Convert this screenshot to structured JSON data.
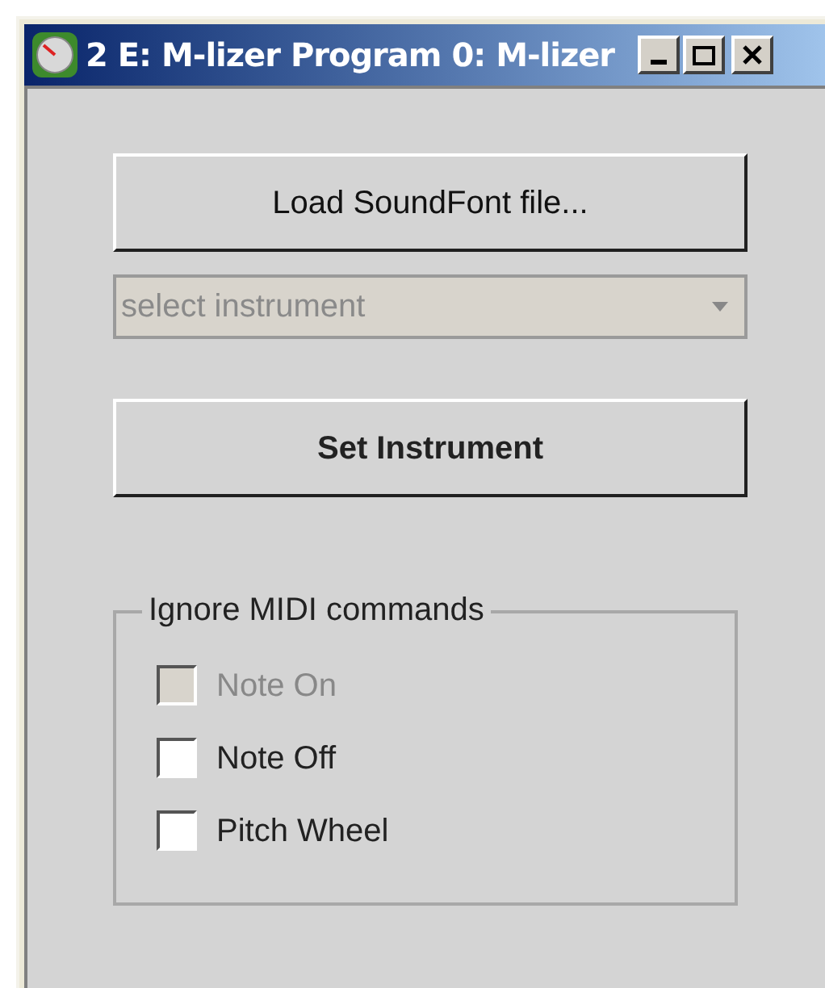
{
  "window": {
    "title": "2 E: M-lizer Program 0: M-lizer"
  },
  "load_button": {
    "label": "Load SoundFont file..."
  },
  "instrument_select": {
    "placeholder": "select instrument",
    "disabled": true
  },
  "set_button": {
    "label": "Set Instrument"
  },
  "ignore_group": {
    "title": "Ignore MIDI commands",
    "options": [
      {
        "label": "Note On",
        "checked": false,
        "disabled": true
      },
      {
        "label": "Note Off",
        "checked": false,
        "disabled": false
      },
      {
        "label": "Pitch Wheel",
        "checked": false,
        "disabled": false
      }
    ]
  }
}
